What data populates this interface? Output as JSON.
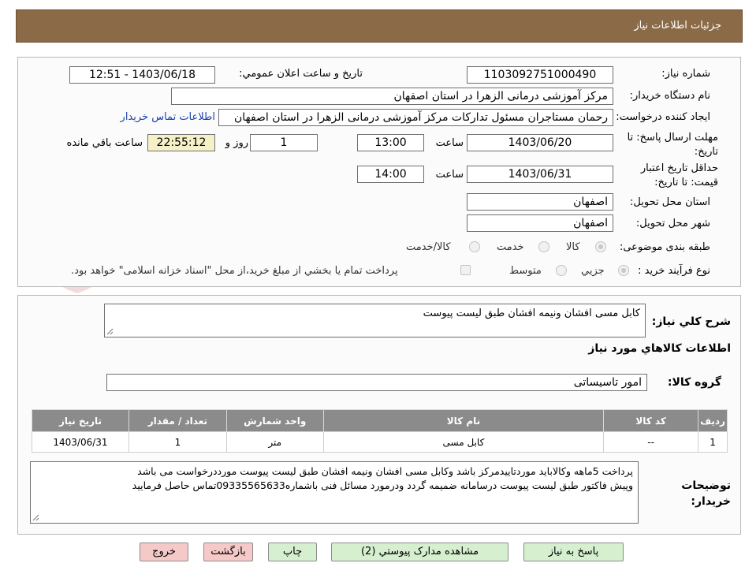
{
  "header": {
    "title": "جزئیات اطلاعات نیاز"
  },
  "info": {
    "need_number_label": "شماره نیاز:",
    "need_number": "1103092751000490",
    "announce_label": "تاریخ و ساعت اعلان عمومي:",
    "announce_value": "1403/06/18 - 12:51",
    "buyer_label": "نام دستگاه خريدار:",
    "buyer_value": "مرکز آموزشی درمانی الزهرا در استان اصفهان",
    "creator_label": "ايجاد کننده درخواست:",
    "creator_value": "رحمان مستاجران مسئول تدارکات مرکز آموزشی درمانی الزهرا در استان اصفهان",
    "contact_link": "اطلاعات تماس خريدار",
    "deadline_label": "مهلت ارسال پاسخ: تا تاريخ:",
    "deadline_date": "1403/06/20",
    "time_label": "ساعت",
    "deadline_time": "13:00",
    "days_value": "1",
    "days_label": "روز و",
    "remaining_time": "22:55:12",
    "remaining_label": "ساعت باقي مانده",
    "validity_label": "حداقل تاريخ اعتبار قيمت: تا تاريخ:",
    "validity_date": "1403/06/31",
    "validity_time": "14:00",
    "province_label": "استان محل تحويل:",
    "province_value": "اصفهان",
    "city_label": "شهر محل تحويل:",
    "city_value": "اصفهان",
    "category_label": "طبقه بندی موضوعی:",
    "category_options": [
      "کالا",
      "خدمت",
      "کالا/خدمت"
    ],
    "category_selected": "کالا",
    "process_label": "نوع فرآيند خريد :",
    "process_options": [
      "جزيي",
      "متوسط"
    ],
    "process_selected": "جزيي",
    "payment_note": "پرداخت تمام يا بخشي از مبلغ خريد،از محل \"اسناد خزانه اسلامی\" خواهد بود."
  },
  "description": {
    "label": "شرح کلي نياز:",
    "value": "کابل مسی افشان  ونیمه افشان طبق لیست پیوست"
  },
  "goods": {
    "section_title": "اطلاعات کالاهاي مورد نياز",
    "group_label": "گروه کالا:",
    "group_value": "امور تاسيساتی",
    "columns": [
      "رديف",
      "کد کالا",
      "نام کالا",
      "واحد شمارش",
      "تعداد / مقدار",
      "تاريخ نياز"
    ],
    "rows": [
      {
        "row": "1",
        "code": "--",
        "name": "کابل مسی",
        "unit": "متر",
        "qty": "1",
        "date": "1403/06/31"
      }
    ]
  },
  "notes": {
    "label": "توضيحات خريدار:",
    "line1": "پرداخت 5ماهه وکالاباید موردتاییدمرکز باشد وکابل مسی افشان ونیمه افشان طبق لیست پیوست مورددرخواست می باشد",
    "line2": "وپیش فاکتور طبق لیست پیوست درسامانه ضمیمه گردد ودرمورد مسائل فنی باشماره09335565633تماس حاصل فرمایید"
  },
  "buttons": {
    "reply": "پاسخ به نياز",
    "attachments": "مشاهده مدارک پيوستي (2)",
    "print": "چاپ",
    "back": "بازگشت",
    "exit": "خروج"
  },
  "watermark": {
    "text": "AriaTender.neT"
  },
  "colors": {
    "header": "#8b6a48",
    "table_header": "#8b8b8b",
    "button_green": "#d6efcf",
    "button_pink": "#f6c9c9",
    "link": "#1d3fae"
  }
}
